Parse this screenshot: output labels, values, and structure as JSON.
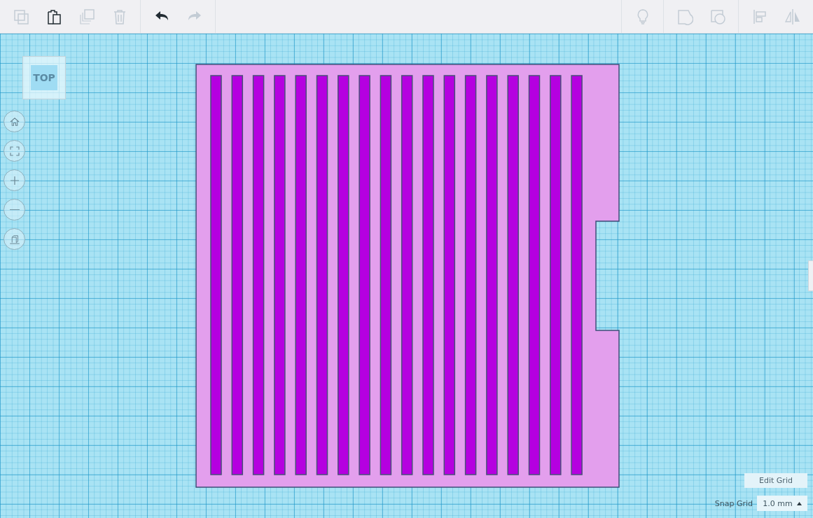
{
  "toolbar": {
    "left": [
      {
        "kind": "copy",
        "disabled": true
      },
      {
        "kind": "paste",
        "disabled": false
      },
      {
        "kind": "duplicate",
        "disabled": true
      },
      {
        "kind": "delete",
        "disabled": true
      }
    ],
    "history": [
      {
        "kind": "undo",
        "disabled": false
      },
      {
        "kind": "redo",
        "disabled": true
      }
    ],
    "right": [
      {
        "kind": "note",
        "disabled": true
      },
      {
        "kind": "group",
        "disabled": true
      },
      {
        "kind": "hole",
        "disabled": true
      },
      {
        "kind": "align",
        "disabled": true
      },
      {
        "kind": "mirror",
        "disabled": true
      }
    ]
  },
  "view_cube": {
    "label": "TOP"
  },
  "view_controls": [
    {
      "kind": "home"
    },
    {
      "kind": "fit"
    },
    {
      "kind": "zoom-in"
    },
    {
      "kind": "zoom-out"
    },
    {
      "kind": "perspective"
    }
  ],
  "grid": {
    "edit_button": "Edit Grid",
    "snap_label": "Snap Grid",
    "snap_value": "1.0 mm"
  }
}
